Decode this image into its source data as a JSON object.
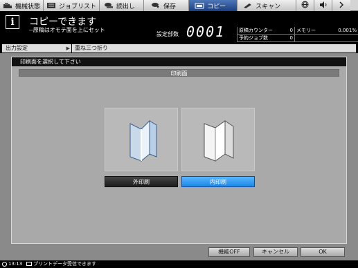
{
  "tabs": [
    {
      "label": "機械状態",
      "icon": "machine-status-icon"
    },
    {
      "label": "ジョブリスト",
      "icon": "job-list-icon"
    },
    {
      "label": "読出し",
      "icon": "recall-icon"
    },
    {
      "label": "保存",
      "icon": "save-icon"
    },
    {
      "label": "コピー",
      "icon": "copy-icon"
    },
    {
      "label": "スキャン",
      "icon": "scan-icon"
    }
  ],
  "header": {
    "title": "コピーできます",
    "subtitle": "--原稿はオモテ面を上にセット",
    "count_label": "設定部数",
    "count_value": "0001",
    "stats": {
      "original_counter_label": "原稿カウンター",
      "original_counter_value": "0",
      "memory_label": "メモリー",
      "memory_value": "0.001%",
      "reserved_jobs_label": "予約ジョブ数",
      "reserved_jobs_value": "0"
    }
  },
  "breadcrumb": {
    "item1": "出力設定",
    "item2": "重ね三つ折り"
  },
  "panel": {
    "instruction": "印刷面を選択して下さい",
    "section_title": "印刷面",
    "options": [
      {
        "label": "外印刷",
        "selected": false
      },
      {
        "label": "内印刷",
        "selected": true
      }
    ]
  },
  "buttons": {
    "function_off": "機能OFF",
    "cancel": "キャンセル",
    "ok": "OK"
  },
  "status": {
    "time": "13:13",
    "message": "プリントデータ受信できます"
  },
  "colors": {
    "active_tab": "#1b3f82",
    "selected_option": "#1d86e6"
  }
}
